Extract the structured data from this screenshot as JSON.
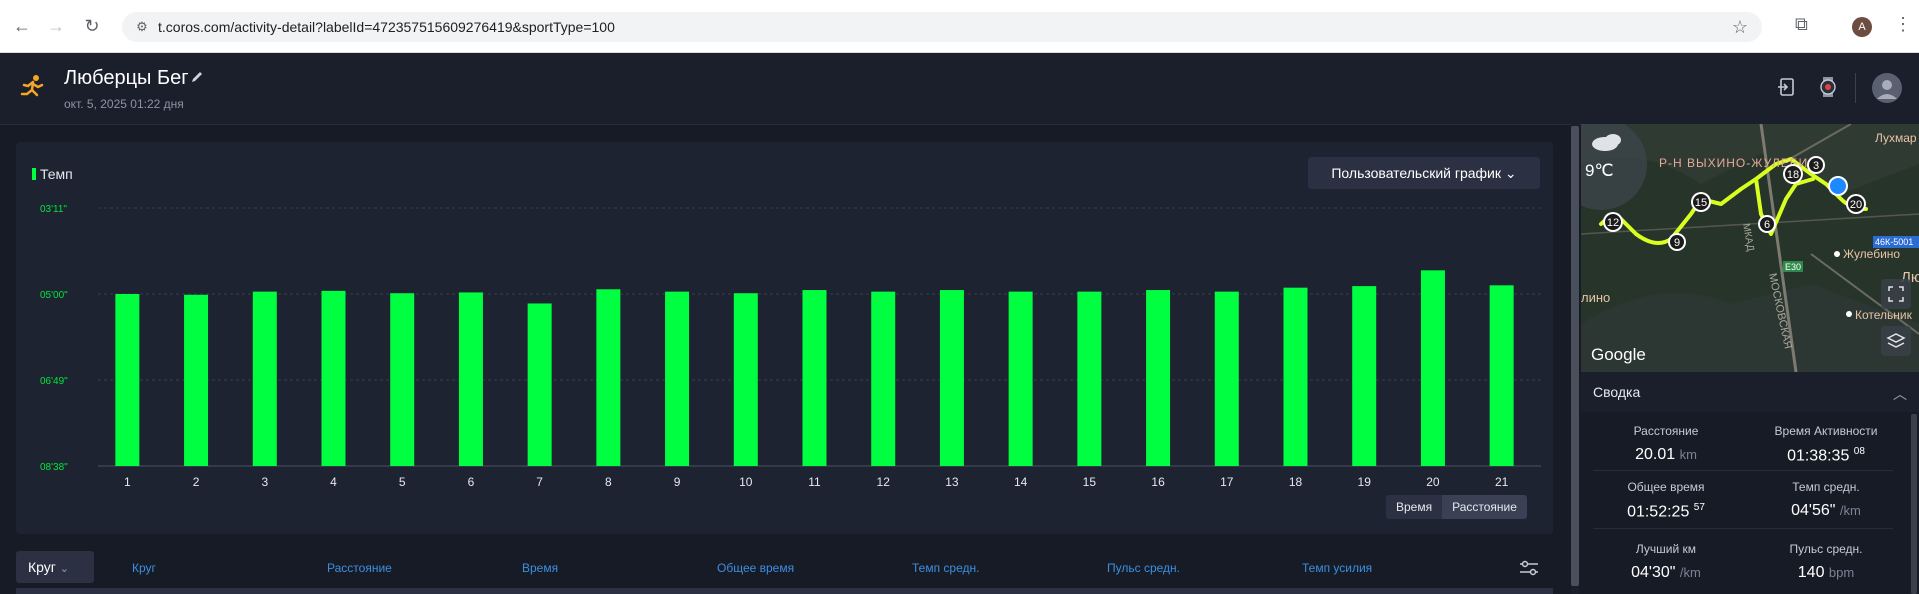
{
  "browser": {
    "url": "t.coros.com/activity-detail?labelId=472357515609276419&sportType=100",
    "profile_initial": "A"
  },
  "header": {
    "title": "Люберцы Бег",
    "date": "окт. 5, 2025 01:22 дня"
  },
  "chart": {
    "legend": "Темп",
    "dropdown": "Пользовательский график ⌄",
    "toggle_time": "Время",
    "toggle_distance": "Расстояние",
    "y_ticks": [
      "03'11\"",
      "05'00\"",
      "06'49\"",
      "08'38\""
    ],
    "accent_color": "#00ff41"
  },
  "chart_data": {
    "type": "bar",
    "series": [
      {
        "values": [
          "5'00\"",
          "5'01\"",
          "4'57\"",
          "4'56\"",
          "4'59\"",
          "4'58\"",
          "5'12\"",
          "4'54\"",
          "4'57\"",
          "4'59\"",
          "4'55\"",
          "4'57\"",
          "4'55\"",
          "4'57\"",
          "4'57\"",
          "4'55\"",
          "4'57\"",
          "4'52\"",
          "4'50\"",
          "4'30\"",
          "4'49\""
        ]
      }
    ],
    "categories": [
      "1",
      "2",
      "3",
      "4",
      "5",
      "6",
      "7",
      "8",
      "9",
      "10",
      "11",
      "12",
      "13",
      "14",
      "15",
      "16",
      "17",
      "18",
      "19",
      "20",
      "21"
    ],
    "values_sec": [
      300,
      301,
      297,
      296,
      299,
      298,
      312,
      294,
      297,
      299,
      295,
      297,
      295,
      297,
      297,
      295,
      297,
      292,
      290,
      270,
      289
    ],
    "ylim": [
      "08'38\"",
      "03'11\""
    ],
    "ylim_sec": [
      518,
      191
    ],
    "y_ticks_sec": [
      191,
      300,
      409,
      518
    ],
    "title": "",
    "xlabel": "",
    "ylabel": ""
  },
  "laps": {
    "dropdown": "Круг",
    "columns": [
      "Круг",
      "Расстояние",
      "Время",
      "Общее время",
      "Темп средн.",
      "Пульс средн.",
      "Темп усилия"
    ]
  },
  "map": {
    "temperature": "9℃",
    "district": "Р-Н ВЫХИНО-ЖУЛЕБИ",
    "place_1": "Лухмар",
    "place_2": "Жулебино",
    "place_3": "Котельник",
    "place_4": "лино",
    "place_5": "Лю",
    "road_1": "МОСКОВСКАЯ",
    "road_2": "МКАД",
    "road_badge_1": "46К-5001",
    "road_badge_2": "E30",
    "brand": "Google",
    "markers": [
      "3",
      "18",
      "20",
      "15",
      "6",
      "12",
      "9"
    ]
  },
  "summary": {
    "title": "Сводка",
    "stats": [
      {
        "label": "Расстояние",
        "value": "20.01",
        "unit": "km",
        "sup": ""
      },
      {
        "label": "Время Активности",
        "value": "01:38:35",
        "unit": "",
        "sup": "08"
      },
      {
        "label": "Общее время",
        "value": "01:52:25",
        "unit": "",
        "sup": "57"
      },
      {
        "label": "Темп средн.",
        "value": "04'56\"",
        "unit": "/km",
        "sup": ""
      },
      {
        "label": "Лучший км",
        "value": "04'30\"",
        "unit": "/km",
        "sup": ""
      },
      {
        "label": "Пульс средн.",
        "value": "140",
        "unit": "bpm",
        "sup": ""
      }
    ]
  }
}
